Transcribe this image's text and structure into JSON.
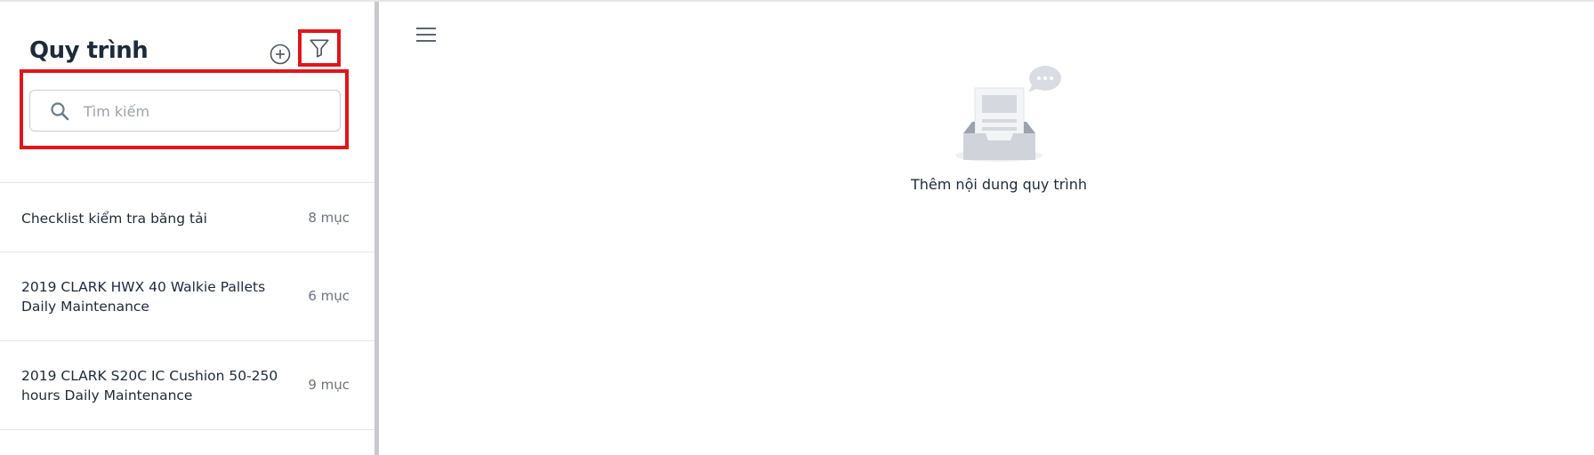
{
  "sidebar": {
    "title": "Quy trình",
    "add_icon": "plus-circle-icon",
    "filter_icon": "filter-icon",
    "search": {
      "placeholder": "Tìm kiếm",
      "value": "",
      "icon": "search-icon"
    },
    "items": [
      {
        "name": "Checklist kiểm tra băng tải",
        "count": "8 mục"
      },
      {
        "name": "2019 CLARK HWX 40 Walkie Pallets Daily Maintenance",
        "count": "6 mục"
      },
      {
        "name": "2019 CLARK S20C IC Cushion 50-250 hours Daily Maintenance",
        "count": "9 mục"
      }
    ]
  },
  "main": {
    "menu_icon": "hamburger-menu-icon",
    "empty_state": {
      "icon": "empty-inbox-icon",
      "text": "Thêm nội dung quy trình"
    }
  },
  "colors": {
    "highlight": "#e0161b",
    "title": "#1e2a3b",
    "muted": "#6b7280",
    "divider": "#c7c9cc"
  }
}
